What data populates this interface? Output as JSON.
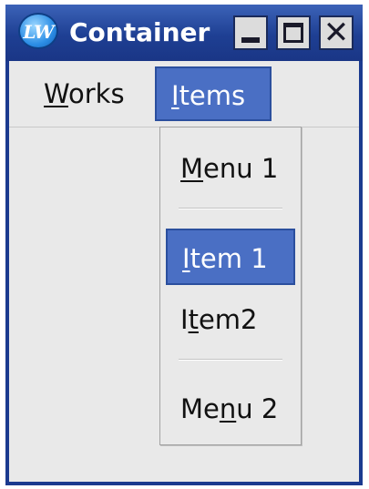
{
  "window": {
    "title": "Container",
    "icon": "LW"
  },
  "titlebar_buttons": {
    "minimize": "minimize-icon",
    "maximize": "maximize-icon",
    "close": "✕"
  },
  "menubar": [
    {
      "pre": "",
      "ul": "W",
      "post": "orks"
    },
    {
      "pre": "",
      "ul": "I",
      "post": "tems"
    }
  ],
  "dropdown": {
    "items": [
      {
        "pre": "",
        "ul": "M",
        "post": "enu 1"
      },
      {
        "pre": "",
        "ul": "I",
        "post": "tem 1",
        "selected": true
      },
      {
        "pre": "I",
        "ul": "t",
        "post": "em2"
      },
      {
        "pre": "Me",
        "ul": "n",
        "post": "u 2"
      }
    ]
  },
  "colors": {
    "selection": "#4a6fc4",
    "titlebar": "#1e3f93",
    "background": "#e9e9e9"
  }
}
